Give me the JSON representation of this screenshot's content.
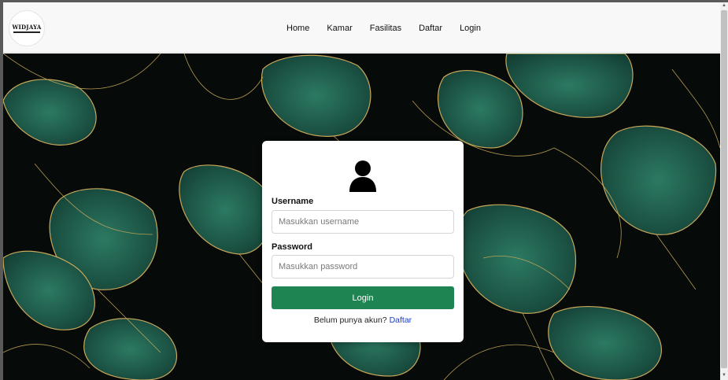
{
  "brand": {
    "logo_text": "WIDJAYA"
  },
  "nav": {
    "items": [
      {
        "label": "Home"
      },
      {
        "label": "Kamar"
      },
      {
        "label": "Fasilitas"
      },
      {
        "label": "Daftar"
      },
      {
        "label": "Login"
      }
    ]
  },
  "login_form": {
    "username_label": "Username",
    "username_placeholder": "Masukkan username",
    "password_label": "Password",
    "password_placeholder": "Masukkan password",
    "submit_label": "Login",
    "register_prompt": "Belum punya akun?",
    "register_link": "Daftar"
  },
  "icons": {
    "user": "user-icon",
    "scroll_up": "chevron-up-icon",
    "scroll_down": "chevron-down-icon"
  },
  "colors": {
    "primary_button": "#1e8451",
    "link": "#1a3cc8",
    "hero_background": "#060a08",
    "leaf_green": "#1f5b4b",
    "leaf_gold": "#c9a85a"
  }
}
